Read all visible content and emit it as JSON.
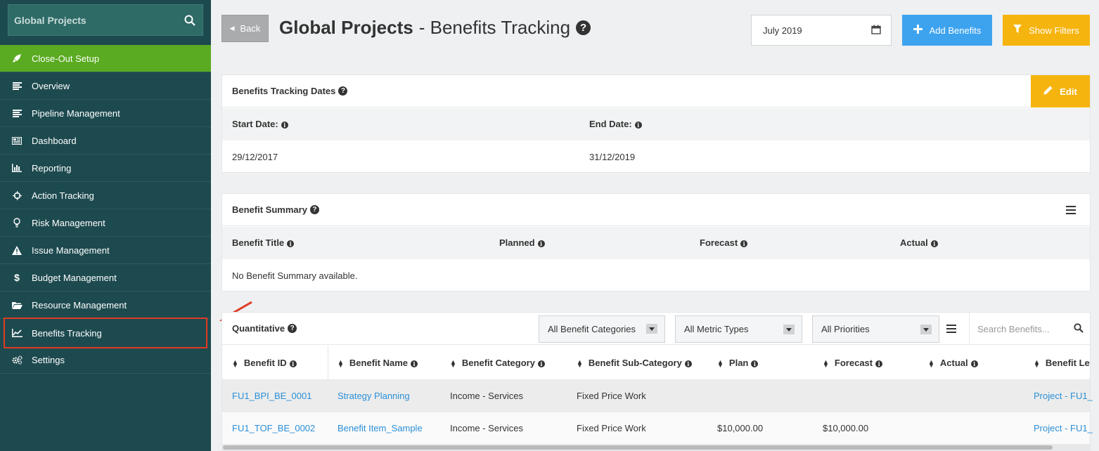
{
  "sidebar": {
    "search_title": "Global Projects",
    "items": [
      {
        "label": "Close-Out Setup",
        "icon": "rocket-icon"
      },
      {
        "label": "Overview",
        "icon": "list-icon"
      },
      {
        "label": "Pipeline Management",
        "icon": "list-icon"
      },
      {
        "label": "Dashboard",
        "icon": "dashboard-icon"
      },
      {
        "label": "Reporting",
        "icon": "bar-chart-icon"
      },
      {
        "label": "Action Tracking",
        "icon": "crosshair-icon"
      },
      {
        "label": "Risk Management",
        "icon": "lightbulb-icon"
      },
      {
        "label": "Issue Management",
        "icon": "warning-icon"
      },
      {
        "label": "Budget Management",
        "icon": "dollar-icon"
      },
      {
        "label": "Resource Management",
        "icon": "folder-icon"
      },
      {
        "label": "Benefits Tracking",
        "icon": "line-chart-icon"
      },
      {
        "label": "Settings",
        "icon": "gears-icon"
      }
    ]
  },
  "header": {
    "back_label": "Back",
    "title_bold": "Global Projects",
    "title_rest": "- Benefits Tracking",
    "date_value": "July 2019",
    "add_label": "Add Benefits",
    "filter_label": "Show Filters"
  },
  "dates_panel": {
    "title": "Benefits Tracking Dates",
    "edit_label": "Edit",
    "start_label": "Start Date:",
    "end_label": "End Date:",
    "start_value": "29/12/2017",
    "end_value": "31/12/2019"
  },
  "summary_panel": {
    "title": "Benefit Summary",
    "columns": [
      "Benefit Title",
      "Planned",
      "Forecast",
      "Actual"
    ],
    "empty_text": "No Benefit Summary available."
  },
  "quant_panel": {
    "title": "Quantitative",
    "filter_category": "All Benefit Categories",
    "filter_metric": "All Metric Types",
    "filter_priority": "All Priorities",
    "search_placeholder": "Search Benefits...",
    "columns": [
      "Benefit ID",
      "Benefit Name",
      "Benefit Category",
      "Benefit Sub-Category",
      "Plan",
      "Forecast",
      "Actual",
      "Benefit Le"
    ],
    "rows": [
      {
        "id": "FU1_BPI_BE_0001",
        "name": "Strategy Planning",
        "category": "Income - Services",
        "subcategory": "Fixed Price Work",
        "plan": "",
        "forecast": "",
        "actual": "",
        "level": "Project - FU1_"
      },
      {
        "id": "FU1_TOF_BE_0002",
        "name": "Benefit Item_Sample",
        "category": "Income - Services",
        "subcategory": "Fixed Price Work",
        "plan": "$10,000.00",
        "forecast": "$10,000.00",
        "actual": "",
        "level": "Project - FU1_"
      }
    ]
  },
  "colors": {
    "sidebar_bg": "#1d4a4f",
    "active_green": "#5aab21",
    "primary_blue": "#3ea3ef",
    "warning_yellow": "#f6b40f",
    "highlight_red": "#e03a22",
    "link_blue": "#2a8fd6"
  }
}
